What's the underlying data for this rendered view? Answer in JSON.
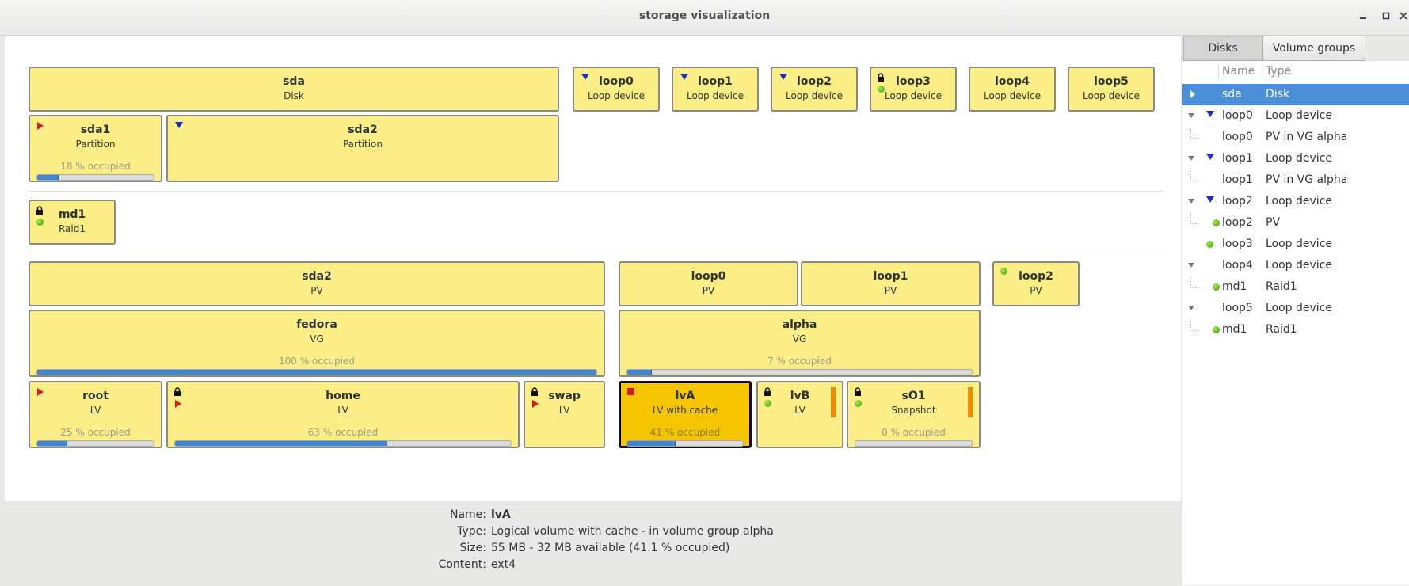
{
  "window": {
    "title": "storage visualization"
  },
  "blocks": {
    "sda": {
      "name": "sda",
      "type": "Disk"
    },
    "loop0": {
      "name": "loop0",
      "type": "Loop device"
    },
    "loop1": {
      "name": "loop1",
      "type": "Loop device"
    },
    "loop2": {
      "name": "loop2",
      "type": "Loop device"
    },
    "loop3": {
      "name": "loop3",
      "type": "Loop device"
    },
    "loop4": {
      "name": "loop4",
      "type": "Loop device"
    },
    "loop5": {
      "name": "loop5",
      "type": "Loop device"
    },
    "sda1": {
      "name": "sda1",
      "type": "Partition",
      "occupied": "18 % occupied",
      "percent": 18
    },
    "sda2part": {
      "name": "sda2",
      "type": "Partition"
    },
    "md1": {
      "name": "md1",
      "type": "Raid1"
    },
    "pv_sda2": {
      "name": "sda2",
      "type": "PV"
    },
    "pv_loop0": {
      "name": "loop0",
      "type": "PV"
    },
    "pv_loop1": {
      "name": "loop1",
      "type": "PV"
    },
    "pv_loop2": {
      "name": "loop2",
      "type": "PV"
    },
    "fedora": {
      "name": "fedora",
      "type": "VG",
      "occupied": "100 % occupied",
      "percent": 100
    },
    "alpha": {
      "name": "alpha",
      "type": "VG",
      "occupied": "7 % occupied",
      "percent": 7
    },
    "root": {
      "name": "root",
      "type": "LV",
      "occupied": "25 % occupied",
      "percent": 25
    },
    "home": {
      "name": "home",
      "type": "LV",
      "occupied": "63 % occupied",
      "percent": 63
    },
    "swap": {
      "name": "swap",
      "type": "LV"
    },
    "lvA": {
      "name": "lvA",
      "type": "LV with cache",
      "occupied": "41 % occupied",
      "percent": 41
    },
    "lvB": {
      "name": "lvB",
      "type": "LV"
    },
    "s01": {
      "name": "sO1",
      "type": "Snapshot",
      "occupied": "0 % occupied",
      "percent": 0
    }
  },
  "details": {
    "name_label": "Name:",
    "name_value": "lvA",
    "type_label": "Type:",
    "type_value": "Logical volume with cache - in volume group alpha",
    "size_label": "Size:",
    "size_value": "55 MB - 32 MB available (41.1 % occupied)",
    "content_label": "Content:",
    "content_value": "ext4"
  },
  "sidebar": {
    "tabs": [
      "Disks",
      "Volume groups"
    ],
    "active_tab": "Disks",
    "columns": [
      "Name",
      "Type"
    ],
    "rows": [
      {
        "name": "sda",
        "type": "Disk"
      },
      {
        "name": "loop0",
        "type": "Loop device"
      },
      {
        "name": "loop0",
        "type": "PV in VG alpha"
      },
      {
        "name": "loop1",
        "type": "Loop device"
      },
      {
        "name": "loop1",
        "type": "PV in VG alpha"
      },
      {
        "name": "loop2",
        "type": "Loop device"
      },
      {
        "name": "loop2",
        "type": "PV"
      },
      {
        "name": "loop3",
        "type": "Loop device"
      },
      {
        "name": "loop4",
        "type": "Loop device"
      },
      {
        "name": "md1",
        "type": "Raid1"
      },
      {
        "name": "loop5",
        "type": "Loop device"
      },
      {
        "name": "md1",
        "type": "Raid1"
      }
    ]
  },
  "colors": {
    "block": "#fbee86",
    "selected": "#f5c600",
    "progress": "#3c87d6",
    "tree_selection": "#4a90d9"
  }
}
